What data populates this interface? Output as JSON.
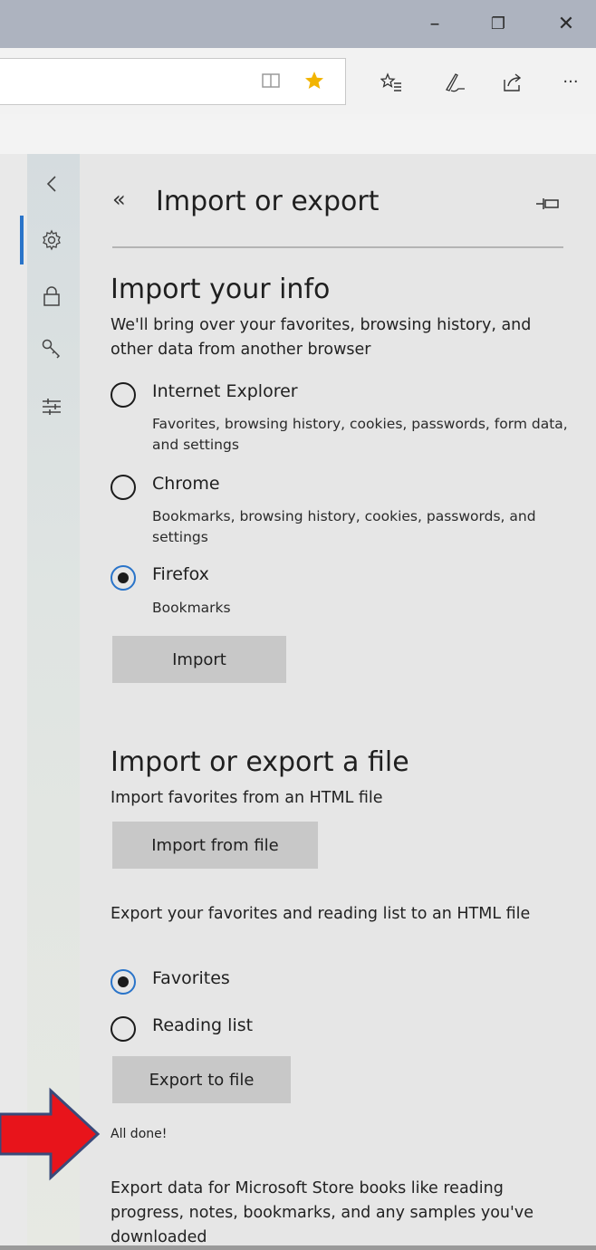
{
  "window_controls": {
    "minimize": "–",
    "restore": "❐",
    "close": "✕"
  },
  "toolbar": {
    "more_label": "···"
  },
  "panel": {
    "title": "Import or export",
    "import_section": {
      "heading": "Import your info",
      "description": "We'll bring over your favorites, browsing history, and other data from another browser",
      "options": [
        {
          "label": "Internet Explorer",
          "desc": "Favorites, browsing history, cookies, passwords, form data, and settings",
          "selected": false
        },
        {
          "label": "Chrome",
          "desc": "Bookmarks, browsing history, cookies, passwords, and settings",
          "selected": false
        },
        {
          "label": "Firefox",
          "desc": "Bookmarks",
          "selected": true
        }
      ],
      "import_button": "Import"
    },
    "file_section": {
      "heading": "Import or export a file",
      "import_desc": "Import favorites from an HTML file",
      "import_button": "Import from file",
      "export_desc": "Export your favorites and reading list to an HTML file",
      "export_options": [
        {
          "label": "Favorites",
          "selected": true
        },
        {
          "label": "Reading list",
          "selected": false
        }
      ],
      "export_button": "Export to file",
      "status": "All done!"
    },
    "store_books_text": "Export data for Microsoft Store books like reading progress, notes, bookmarks, and any samples you've downloaded"
  },
  "colors": {
    "accent": "#2a74c9",
    "arrow_fill": "#e8141b",
    "arrow_border": "#3a4a7a",
    "favorite_star": "#f2b400"
  }
}
